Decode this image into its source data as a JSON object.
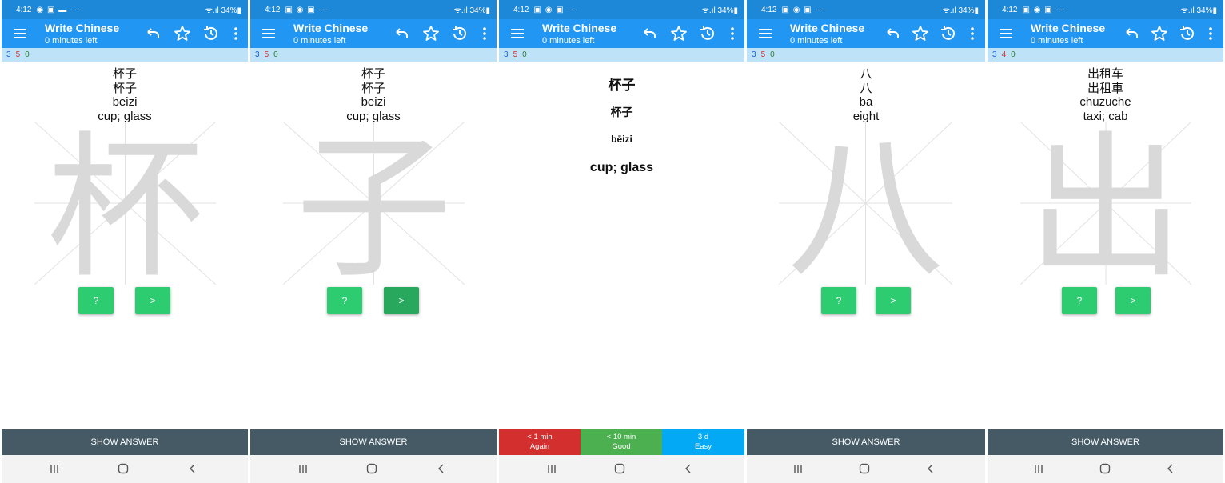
{
  "status_bar": {
    "time": "4:12",
    "left_icons": [
      "◉ ▣ ▬ ···",
      "▣ ◉ ▣ ···",
      "▣ ◉ ▣ ···",
      "▣ ◉ ▣ ···",
      "▣ ◉ ▣ ···"
    ],
    "right": "ᯤ.ıl 34%▮"
  },
  "toolbar": {
    "title": "Write Chinese",
    "subtitle": "0 minutes left",
    "icons": [
      "menu-icon",
      "undo-icon",
      "star-icon",
      "history-icon",
      "more-vertical-icon"
    ]
  },
  "colors": {
    "status_bar": "#1e88d8",
    "toolbar": "#2196f3",
    "counts_bar": "#bee3f8",
    "button_green": "#2ecc71",
    "show_answer_bar": "#455a64",
    "again_red": "#d32f2f",
    "good_green": "#4caf50",
    "easy_blue": "#03a9f4",
    "stroke_hint": "#d9d9d9"
  },
  "screens": [
    {
      "counts": {
        "new": "3",
        "learn": "5",
        "review": "0"
      },
      "lines": [
        "杯子",
        "杯子",
        "bēizi",
        "cup; glass"
      ],
      "hint_char": "杯",
      "buttons": {
        "hint": "?",
        "next": ">"
      },
      "show_answer": "SHOW ANSWER"
    },
    {
      "counts": {
        "new": "3",
        "learn": "5",
        "review": "0"
      },
      "lines": [
        "杯子",
        "杯子",
        "bēizi",
        "cup; glass"
      ],
      "hint_char": "子",
      "buttons": {
        "hint": "?",
        "next": ">"
      },
      "show_answer": "SHOW ANSWER"
    },
    {
      "counts": {
        "new": "3",
        "learn": "5",
        "review": "0"
      },
      "answer_lines": [
        "杯子",
        "杯子",
        "bēizi",
        "cup; glass"
      ],
      "ease_buttons": [
        {
          "interval": "< 1 min",
          "label": "Again"
        },
        {
          "interval": "< 10 min",
          "label": "Good"
        },
        {
          "interval": "3 d",
          "label": "Easy"
        }
      ]
    },
    {
      "counts": {
        "new": "3",
        "learn": "5",
        "review": "0"
      },
      "lines": [
        "八",
        "八",
        "bā",
        "eight"
      ],
      "hint_char": "八",
      "buttons": {
        "hint": "?",
        "next": ">"
      },
      "show_answer": "SHOW ANSWER"
    },
    {
      "counts": {
        "new": "3",
        "learn": "4",
        "review": "0"
      },
      "lines": [
        "出租车",
        "出租車",
        "chūzūchē",
        "taxi; cab"
      ],
      "hint_char": "出",
      "buttons": {
        "hint": "?",
        "next": ">"
      },
      "show_answer": "SHOW ANSWER"
    }
  ],
  "nav_bar": [
    "recent-apps-icon",
    "home-icon",
    "back-icon"
  ]
}
